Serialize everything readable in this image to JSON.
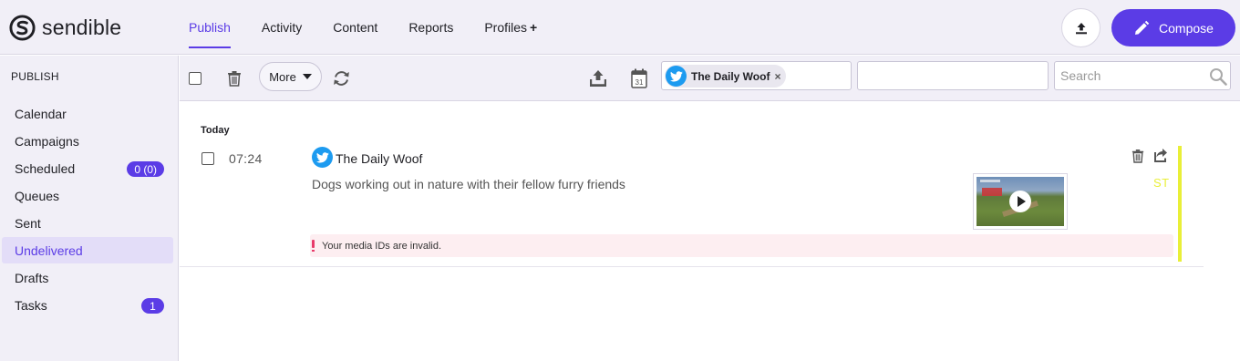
{
  "app": {
    "brand": "sendible",
    "colors": {
      "accent": "#5b3ce6",
      "status_scheduled": "#e9ef38",
      "error": "#e83a6a",
      "twitter": "#1d9bf0"
    }
  },
  "nav": {
    "items": [
      {
        "label": "Publish",
        "active": true
      },
      {
        "label": "Activity"
      },
      {
        "label": "Content"
      },
      {
        "label": "Reports"
      },
      {
        "label": "Profiles",
        "suffix": "+"
      }
    ],
    "upload_icon": "upload-icon",
    "compose_label": "Compose",
    "compose_icon": "pencil-icon"
  },
  "sidebar": {
    "heading": "PUBLISH",
    "items": [
      {
        "label": "Calendar"
      },
      {
        "label": "Campaigns"
      },
      {
        "label": "Scheduled",
        "badge": "0 (0)"
      },
      {
        "label": "Queues"
      },
      {
        "label": "Sent"
      },
      {
        "label": "Undelivered",
        "active": true
      },
      {
        "label": "Drafts"
      },
      {
        "label": "Tasks",
        "badge": "1"
      }
    ]
  },
  "toolbar": {
    "more_label": "More",
    "profile_chip": "The Daily Woof",
    "profile_chip_remove": "×",
    "filter_value": "",
    "search_placeholder": "Search",
    "icons": [
      "checkbox",
      "trash-icon",
      "refresh-icon",
      "export-icon",
      "calendar-icon",
      "search-icon"
    ],
    "calendar_day": "31"
  },
  "feed": {
    "day_label": "Today",
    "posts": [
      {
        "time": "07:24",
        "profile": "The Daily Woof",
        "network_icon": "twitter-icon",
        "text": "Dogs working out in nature with their fellow furry friends",
        "status": "ST",
        "error": "Your media IDs are invalid.",
        "media": "video-thumbnail"
      }
    ]
  }
}
